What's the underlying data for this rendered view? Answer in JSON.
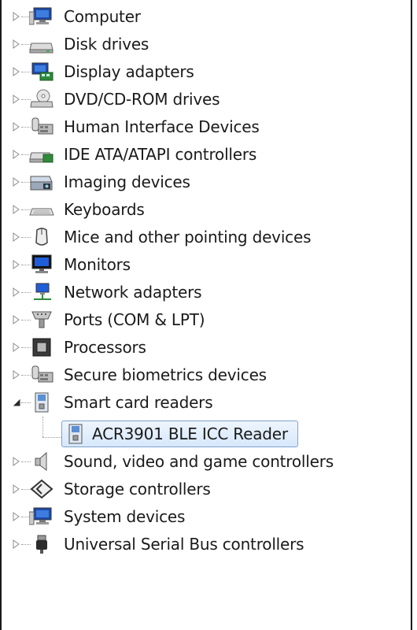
{
  "device_tree": {
    "items": [
      {
        "label": "Computer",
        "icon": "computer-icon",
        "expanded": false
      },
      {
        "label": "Disk drives",
        "icon": "disk-drive-icon",
        "expanded": false
      },
      {
        "label": "Display adapters",
        "icon": "display-adapter-icon",
        "expanded": false
      },
      {
        "label": "DVD/CD-ROM drives",
        "icon": "dvd-drive-icon",
        "expanded": false
      },
      {
        "label": "Human Interface Devices",
        "icon": "hid-icon",
        "expanded": false
      },
      {
        "label": "IDE ATA/ATAPI controllers",
        "icon": "ide-controller-icon",
        "expanded": false
      },
      {
        "label": "Imaging devices",
        "icon": "imaging-device-icon",
        "expanded": false
      },
      {
        "label": "Keyboards",
        "icon": "keyboard-icon",
        "expanded": false
      },
      {
        "label": "Mice and other pointing devices",
        "icon": "mouse-icon",
        "expanded": false
      },
      {
        "label": "Monitors",
        "icon": "monitor-icon",
        "expanded": false
      },
      {
        "label": "Network adapters",
        "icon": "network-adapter-icon",
        "expanded": false
      },
      {
        "label": "Ports (COM & LPT)",
        "icon": "port-icon",
        "expanded": false
      },
      {
        "label": "Processors",
        "icon": "processor-icon",
        "expanded": false
      },
      {
        "label": "Secure biometrics devices",
        "icon": "biometric-icon",
        "expanded": false
      },
      {
        "label": "Smart card readers",
        "icon": "smart-card-reader-icon",
        "expanded": true,
        "children": [
          {
            "label": "ACR3901 BLE ICC Reader",
            "icon": "smart-card-reader-icon",
            "selected": true
          }
        ]
      },
      {
        "label": "Sound, video and game controllers",
        "icon": "speaker-icon",
        "expanded": false
      },
      {
        "label": "Storage controllers",
        "icon": "storage-controller-icon",
        "expanded": false
      },
      {
        "label": "System devices",
        "icon": "computer-icon",
        "expanded": false
      },
      {
        "label": "Universal Serial Bus controllers",
        "icon": "usb-icon",
        "expanded": false
      }
    ]
  },
  "colors": {
    "selection_border": "#7da2ce",
    "selection_fill": "#dbe9fb",
    "text": "#1a1a1a",
    "tree_lines": "#9a9a9a"
  }
}
